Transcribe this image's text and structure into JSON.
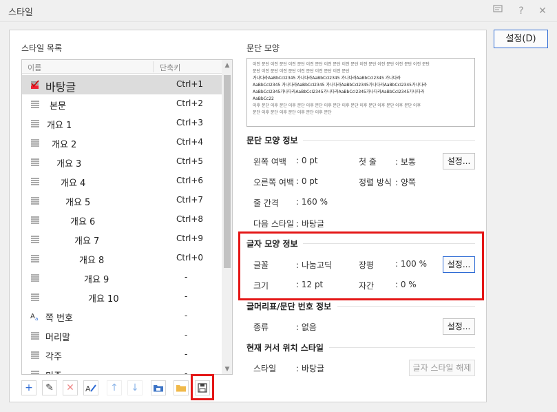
{
  "window": {
    "title": "스타일",
    "help_icon": "?",
    "close_icon": "✕"
  },
  "style_list": {
    "label": "스타일 목록",
    "columns": {
      "name": "이름",
      "shortcut": "단축키"
    },
    "items": [
      {
        "name": "바탕글",
        "shortcut": "Ctrl+1",
        "indent": 0,
        "icon": "body-text-check-icon",
        "selected": true
      },
      {
        "name": "본문",
        "shortcut": "Ctrl+2",
        "indent": 6,
        "icon": "paragraph-icon"
      },
      {
        "name": "개요 1",
        "shortcut": "Ctrl+3",
        "indent": 2,
        "icon": "paragraph-icon"
      },
      {
        "name": "개요 2",
        "shortcut": "Ctrl+4",
        "indent": 9,
        "icon": "paragraph-icon"
      },
      {
        "name": "개요 3",
        "shortcut": "Ctrl+5",
        "indent": 16,
        "icon": "paragraph-icon"
      },
      {
        "name": "개요 4",
        "shortcut": "Ctrl+6",
        "indent": 22,
        "icon": "paragraph-icon"
      },
      {
        "name": "개요 5",
        "shortcut": "Ctrl+7",
        "indent": 29,
        "icon": "paragraph-icon"
      },
      {
        "name": "개요 6",
        "shortcut": "Ctrl+8",
        "indent": 36,
        "icon": "paragraph-icon"
      },
      {
        "name": "개요 7",
        "shortcut": "Ctrl+9",
        "indent": 42,
        "icon": "paragraph-icon"
      },
      {
        "name": "개요 8",
        "shortcut": "Ctrl+0",
        "indent": 49,
        "icon": "paragraph-icon"
      },
      {
        "name": "개요 9",
        "shortcut": "-",
        "indent": 56,
        "icon": "paragraph-icon"
      },
      {
        "name": "개요 10",
        "shortcut": "-",
        "indent": 62,
        "icon": "paragraph-icon"
      },
      {
        "name": "쪽 번호",
        "shortcut": "-",
        "indent": 0,
        "icon": "char-style-icon"
      },
      {
        "name": "머리말",
        "shortcut": "-",
        "indent": 0,
        "icon": "paragraph-icon"
      },
      {
        "name": "각주",
        "shortcut": "-",
        "indent": 0,
        "icon": "paragraph-icon"
      },
      {
        "name": "미주",
        "shortcut": "-",
        "indent": 0,
        "icon": "paragraph-icon"
      }
    ]
  },
  "toolbar": {
    "add": "+",
    "edit": "✎",
    "delete": "✕",
    "up": "↑",
    "down": "↓"
  },
  "preview": {
    "label": "문단 모양",
    "lines": [
      "이전 문단 이전 문단 이전 문단 이전 문단 이전 문단 이전 문단 이전 문단 이전 문단 이전 문단 이전 문단",
      "문단 이전 문단 이전 문단 이전 문단 이전 문단 이전 문단",
      "가나다라AaBbCcI2345 가나다라AaBbCcI2345 가나다라AaBbCcI2345 가나다라",
      "AaBbCcI2345 가나다라AaBbCcI2345 가나다라AaBbCcI2345가나다라AaBbCcI2345가나다라",
      "AaBbCcI2345가나다라AaBbCcI2345가나다라AaBbCcI2345가나다라AaBbCcI2345가나다라",
      "AaBbCc22",
      "이후 문단 이후 문단 이후 문단 이후 문단 이후 문단 이후 문단 이후 문단 이후 문단 이후 문단 이후",
      "문단 이후 문단 이후 문단 이후 문단 이후 문단"
    ]
  },
  "para_info": {
    "title": "문단 모양 정보",
    "left_margin_label": "왼쪽 여백",
    "left_margin": ": 0 pt",
    "right_margin_label": "오른쪽 여백",
    "right_margin": ": 0 pt",
    "first_line_label": "첫 줄",
    "first_line": ": 보통",
    "align_label": "정렬 방식",
    "align": ": 양쪽",
    "line_spacing_label": "줄 간격",
    "line_spacing": ": 160 %",
    "next_style_label": "다음 스타일",
    "next_style": ": 바탕글",
    "settings_button": "설정..."
  },
  "char_info": {
    "title": "글자 모양 정보",
    "font_label": "글꼴",
    "font": ": 나눔고딕",
    "ratio_label": "장평",
    "ratio": ": 100 %",
    "size_label": "크기",
    "size": ": 12 pt",
    "spacing_label": "자간",
    "spacing": ": 0 %",
    "settings_button": "설정..."
  },
  "numbering_info": {
    "title": "글머리표/문단 번호 정보",
    "type_label": "종류",
    "type": ": 없음",
    "settings_button": "설정..."
  },
  "cursor_style": {
    "title": "현재 커서 위치 스타일",
    "style_label": "스타일",
    "style": ": 바탕글",
    "release_button": "글자 스타일 해제"
  },
  "main_button": "설정(D)",
  "colors": {
    "highlight": "#e41616",
    "focus": "#2d6ad4"
  }
}
